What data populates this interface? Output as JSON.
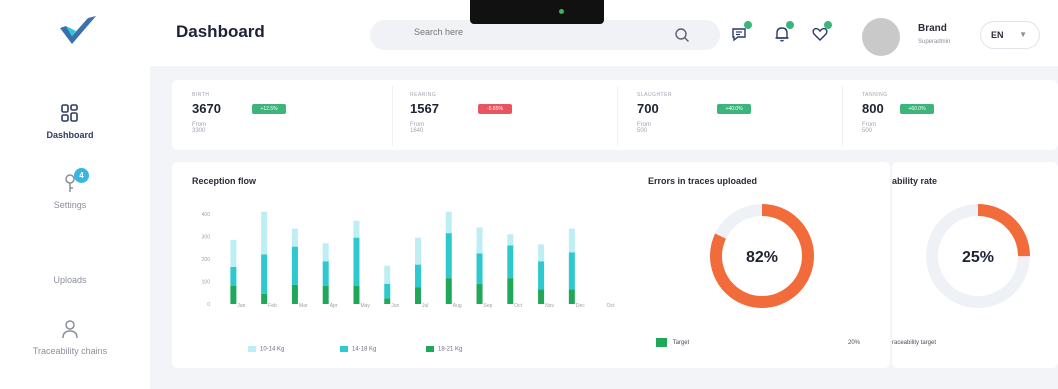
{
  "sidebar": {
    "items": [
      {
        "label": "Dashboard",
        "icon": "dashboard-grid-icon",
        "active": true
      },
      {
        "label": "Settings",
        "icon": "key-icon",
        "badge": "4"
      },
      {
        "label": "Uploads",
        "icon": "upload-icon"
      },
      {
        "label": "Traceability chains",
        "icon": "user-icon"
      }
    ]
  },
  "header": {
    "title": "Dashboard",
    "search_placeholder": "Search here",
    "user_name": "Brand",
    "user_role": "Superadmin",
    "language": "EN"
  },
  "stats": [
    {
      "label": "BIRTH",
      "value": "3670",
      "pill": "+12.5%",
      "pill_color": "#3cb57a",
      "sub": "From 3300"
    },
    {
      "label": "REARING",
      "value": "1567",
      "pill": "-5.85%",
      "pill_color": "#e8555f",
      "sub": "From 1640"
    },
    {
      "label": "SLAUGHTER",
      "value": "700",
      "pill": "+40.0%",
      "pill_color": "#3cb57a",
      "sub": "From 500"
    },
    {
      "label": "TANNING",
      "value": "800",
      "pill": "+60.0%",
      "pill_color": "#3cb57a",
      "sub": "From 500"
    }
  ],
  "reception_flow": {
    "title": "Reception flow",
    "legend": [
      "10-14 Kg",
      "14-18 Kg",
      "18-21 Kg"
    ]
  },
  "errors_card": {
    "title": "Errors in traces uploaded",
    "percent_label": "82%",
    "target_label": "Target",
    "target_value": "20%"
  },
  "traceability_card": {
    "title": "ability rate",
    "percent_label": "25%",
    "target_label": "raceability target"
  },
  "colors": {
    "light_series": "#bdeef3",
    "mid_series": "#2ec9cf",
    "dark_series": "#1fa85a",
    "donut_accent": "#f26b3a",
    "donut_track": "#eef2f6"
  },
  "chart_data": {
    "type": "bar",
    "stacked": true,
    "categories": [
      "Jan",
      "Feb",
      "Mar",
      "Apr",
      "May",
      "Jun",
      "Jul",
      "Aug",
      "Sep",
      "Oct",
      "Nov",
      "Dec",
      "Oct"
    ],
    "y_ticks": [
      "400",
      "300",
      "200",
      "100",
      "0"
    ],
    "ylim": [
      0,
      400
    ],
    "series": [
      {
        "name": "18-21 Kg",
        "values": [
          80,
          45,
          85,
          80,
          80,
          25,
          75,
          115,
          90,
          115,
          65,
          65,
          0
        ]
      },
      {
        "name": "14-18 Kg",
        "values": [
          85,
          175,
          170,
          110,
          215,
          65,
          100,
          200,
          135,
          145,
          125,
          165,
          0
        ]
      },
      {
        "name": "10-14 Kg",
        "values": [
          120,
          190,
          80,
          80,
          75,
          80,
          120,
          95,
          115,
          50,
          75,
          105,
          0
        ]
      }
    ],
    "donuts": [
      {
        "title": "Errors in traces uploaded",
        "value": 82
      },
      {
        "title": "ability rate",
        "value": 25
      }
    ],
    "grid": false,
    "legend_position": "bottom"
  }
}
